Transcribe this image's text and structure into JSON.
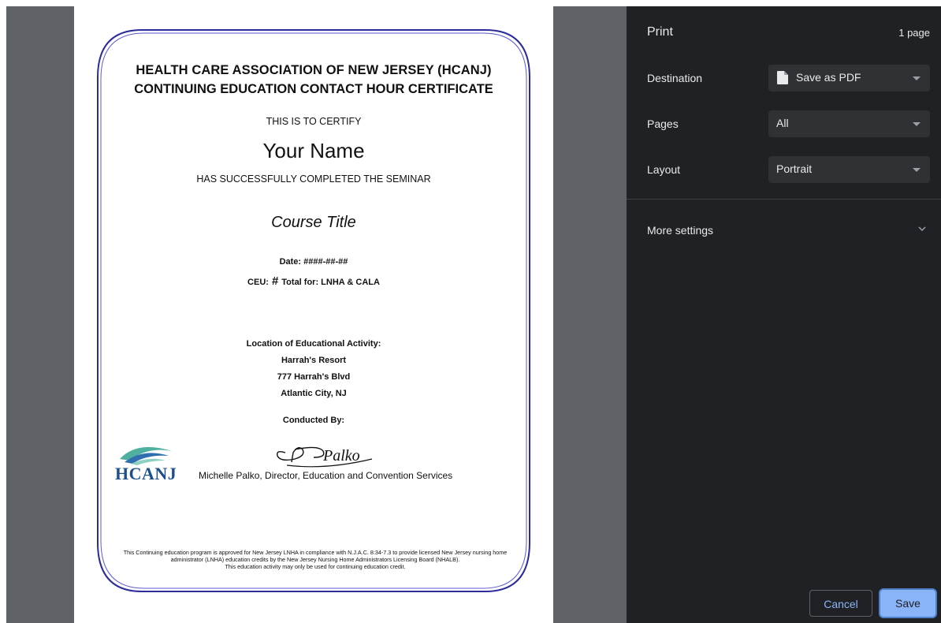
{
  "certificate": {
    "header_line1": "HEALTH CARE ASSOCIATION OF NEW JERSEY (HCANJ)",
    "header_line2": "CONTINUING EDUCATION CONTACT HOUR CERTIFICATE",
    "certify": "THIS IS TO CERTIFY",
    "name": "Your Name",
    "completed": "HAS SUCCESSFULLY COMPLETED THE SEMINAR",
    "course_title": "Course Title",
    "date_label": "Date: ####-##-##",
    "ceu_prefix": "CEU:",
    "ceu_hash": "#",
    "ceu_suffix": "Total for: LNHA & CALA",
    "location_label": "Location of Educational Activity:",
    "location_line1": "Harrah's Resort",
    "location_line2": "777 Harrah's Blvd",
    "location_line3": "Atlantic City, NJ",
    "conducted_by": "Conducted By:",
    "signature_text": "Palko",
    "signer": "Michelle Palko, Director, Education and Convention Services",
    "logo_text": "HCANJ",
    "disclaimer_line1": "This Continuing education program is approved for New Jersey LNHA in compliance with N.J.A.C. 8:34-7.3 to provide licensed New Jersey nursing home administrator (LNHA) education credits by the New Jersey Nursing Home Administrators Licensing Board (NHALB).",
    "disclaimer_line2": "This education activity may only be used for continuing education credit."
  },
  "print_panel": {
    "title": "Print",
    "page_count": "1 page",
    "destination_label": "Destination",
    "destination_value": "Save as PDF",
    "pages_label": "Pages",
    "pages_value": "All",
    "layout_label": "Layout",
    "layout_value": "Portrait",
    "more_settings": "More settings",
    "cancel": "Cancel",
    "save": "Save"
  },
  "colors": {
    "panel_bg": "#202124",
    "preview_bg": "#5f6368",
    "accent": "#8ab4f8",
    "border": "#2b2b9a"
  },
  "icons": [
    "document-icon",
    "chevron-down-icon",
    "dropdown-arrow-icon"
  ]
}
